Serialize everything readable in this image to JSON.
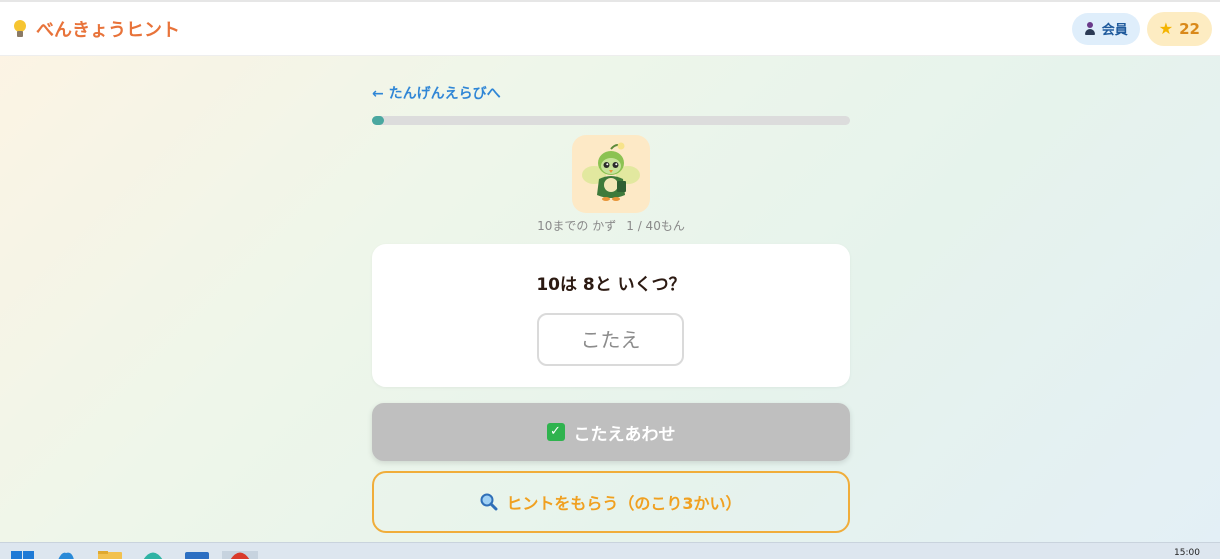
{
  "header": {
    "title": "べんきょうヒント",
    "logo_icon": "lightbulb-icon",
    "member_label": "会員",
    "member_icon": "user-icon",
    "stars": "22",
    "star_icon": "star-icon"
  },
  "nav": {
    "back_label": "← たんげんえらびへ"
  },
  "progress": {
    "current": 1,
    "total": 40,
    "fraction": 0.025
  },
  "quiz": {
    "unit_label": "10までの かず",
    "counter": "1 / 40もん",
    "question": "10は 8と いくつ？",
    "answer_placeholder": "こたえ",
    "answer_value": ""
  },
  "actions": {
    "check_label": "こたえあわせ",
    "check_icon": "checkbox-icon",
    "hint_label": "ヒントをもらう（のこり3かい）",
    "hint_icon": "magnifier-icon"
  },
  "taskbar": {
    "clock": "15:00"
  },
  "colors": {
    "brand": "#e8733a",
    "link": "#2f86d6",
    "progress": "#4aa8a0",
    "hint": "#f0ad3a",
    "check_bg": "#bfbfbf"
  }
}
